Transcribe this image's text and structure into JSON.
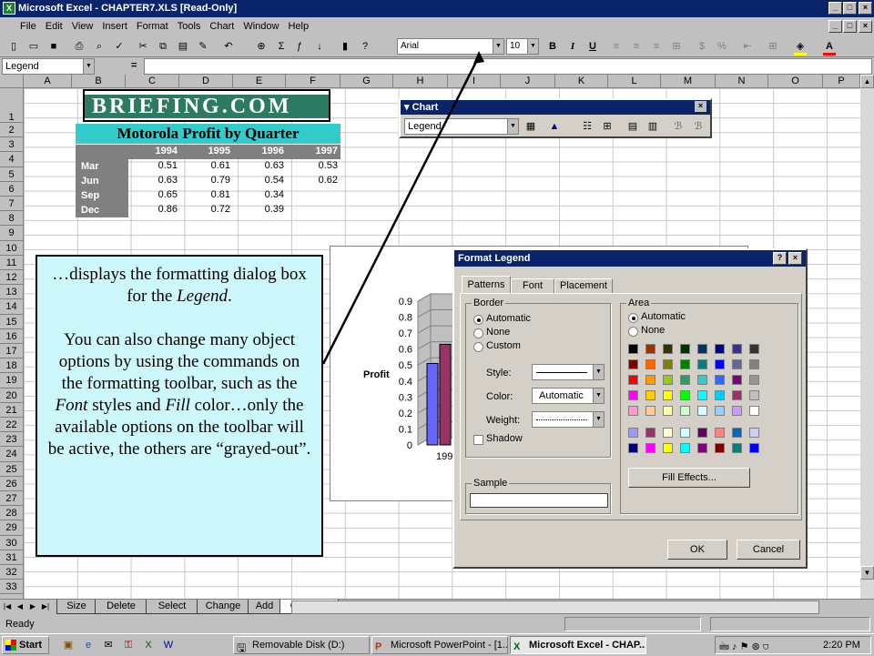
{
  "window": {
    "title": "Microsoft Excel - CHAPTER7.XLS  [Read-Only]"
  },
  "menu": {
    "items": [
      "File",
      "Edit",
      "View",
      "Insert",
      "Format",
      "Tools",
      "Chart",
      "Window",
      "Help"
    ]
  },
  "toolbar": {
    "font_name": "Arial",
    "font_size": "10",
    "bold": "B",
    "italic": "I",
    "underline": "U"
  },
  "formula_bar": {
    "name_box": "Legend",
    "equals": "="
  },
  "columns": [
    "A",
    "B",
    "C",
    "D",
    "E",
    "F",
    "G",
    "H",
    "I",
    "J",
    "K",
    "L",
    "M",
    "N",
    "O",
    "P"
  ],
  "rows": [
    "1",
    "2",
    "3",
    "4",
    "5",
    "6",
    "7",
    "8",
    "9",
    "10",
    "11",
    "12",
    "13",
    "14",
    "15",
    "16",
    "17",
    "18",
    "19",
    "20",
    "21",
    "22",
    "23",
    "24",
    "25",
    "26",
    "27",
    "28",
    "29",
    "30",
    "31",
    "32",
    "33"
  ],
  "sheet": {
    "logo": "BRIEFING.COM",
    "table_title": "Motorola Profit by Quarter",
    "years": [
      "1994",
      "1995",
      "1996",
      "1997"
    ],
    "quarters": [
      "Mar",
      "Jun",
      "Sep",
      "Dec"
    ],
    "values": [
      [
        "0.51",
        "0.61",
        "0.63",
        "0.53"
      ],
      [
        "0.63",
        "0.79",
        "0.54",
        "0.62"
      ],
      [
        "0.65",
        "0.81",
        "0.34",
        ""
      ],
      [
        "0.86",
        "0.72",
        "0.39",
        ""
      ]
    ]
  },
  "chart_toolbar": {
    "title": "Chart",
    "object": "Legend"
  },
  "chart": {
    "ylabel": "Profit",
    "ticks": [
      "0.9",
      "0.8",
      "0.7",
      "0.6",
      "0.5",
      "0.4",
      "0.3",
      "0.2",
      "0.1",
      "0"
    ],
    "xlabel_partial": "199"
  },
  "chart_data": {
    "type": "bar",
    "title": "",
    "ylabel": "Profit",
    "ylim": [
      0,
      0.9
    ],
    "categories": [
      "1994"
    ],
    "series": [
      {
        "name": "",
        "values": [
          0.51
        ]
      },
      {
        "name": "",
        "values": [
          0.63
        ]
      }
    ]
  },
  "callout": {
    "p1_a": "…displays the formatting dialog box for the ",
    "p1_em": "Legend",
    "p1_b": ".",
    "p2_a": "You can also change many object options by using the commands on the formatting toolbar, such as the ",
    "p2_em1": "Font",
    "p2_b": " styles and ",
    "p2_em2": "Fill",
    "p2_c": " color…only the available options on the toolbar will be active, the others are “grayed-out”."
  },
  "dialog": {
    "title": "Format Legend",
    "help": "?",
    "close": "×",
    "tabs": [
      "Patterns",
      "Font",
      "Placement"
    ],
    "border": {
      "label": "Border",
      "automatic": "Automatic",
      "none": "None",
      "custom": "Custom",
      "style": "Style:",
      "color": "Color:",
      "color_value": "Automatic",
      "weight": "Weight:",
      "shadow": "Shadow"
    },
    "area": {
      "label": "Area",
      "automatic": "Automatic",
      "none": "None",
      "fill_effects": "Fill Effects..."
    },
    "sample": "Sample",
    "ok": "OK",
    "cancel": "Cancel",
    "palette": [
      "#000000",
      "#993300",
      "#333300",
      "#003300",
      "#003366",
      "#000080",
      "#333399",
      "#333333",
      "#800000",
      "#ff6600",
      "#808000",
      "#008000",
      "#008080",
      "#0000ff",
      "#666699",
      "#808080",
      "#ff0000",
      "#ff9900",
      "#99cc00",
      "#339966",
      "#33cccc",
      "#3366ff",
      "#800080",
      "#969696",
      "#ff00ff",
      "#ffcc00",
      "#ffff00",
      "#00ff00",
      "#00ffff",
      "#00ccff",
      "#993366",
      "#c0c0c0",
      "#ff99cc",
      "#ffcc99",
      "#ffff99",
      "#ccffcc",
      "#ccffff",
      "#99ccff",
      "#cc99ff",
      "#ffffff"
    ],
    "palette2": [
      "#9999ff",
      "#993366",
      "#ffffcc",
      "#ccffff",
      "#660066",
      "#ff8080",
      "#0066cc",
      "#ccccff",
      "#000080",
      "#ff00ff",
      "#ffff00",
      "#00ffff",
      "#800080",
      "#800000",
      "#008080",
      "#0000ff"
    ]
  },
  "sheet_tabs": [
    "Size",
    "Delete",
    "Select",
    "Change",
    "Add",
    "Options"
  ],
  "status": "Ready",
  "taskbar": {
    "start": "Start",
    "tasks": [
      "Removable Disk (D:)",
      "Microsoft PowerPoint - [1...",
      "Microsoft Excel - CHAP..."
    ],
    "time": "2:20 PM"
  }
}
